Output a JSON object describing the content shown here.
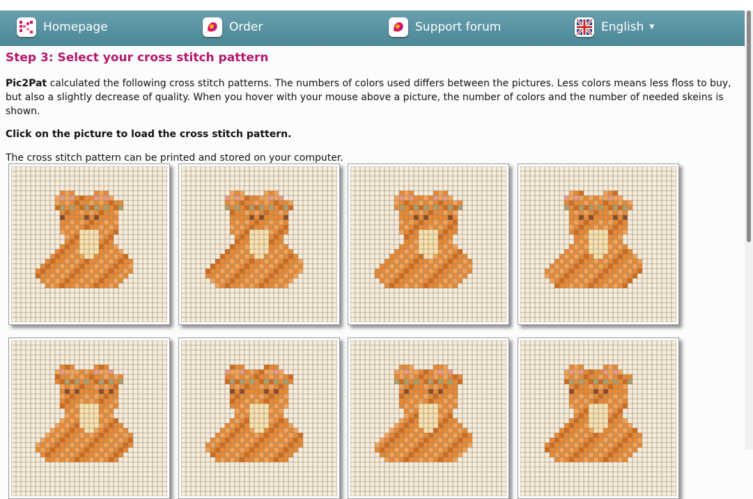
{
  "nav": {
    "items": [
      {
        "label": "Homepage",
        "icon": "pic2pat-logo-icon"
      },
      {
        "label": "Order",
        "icon": "order-icon"
      },
      {
        "label": "Support forum",
        "icon": "support-icon"
      },
      {
        "label": "English",
        "icon": "uk-flag-icon",
        "dropdown": true
      }
    ]
  },
  "main": {
    "heading": "Step 3: Select your cross stitch pattern",
    "brand": "Pic2Pat",
    "intro": " calculated the following cross stitch patterns. The numbers of colors used differs between the pictures. Less colors means less floss to buy, but also a slightly decrease of quality. When you hover with your mouse above a picture, the number of colors and the number of needed skeins is shown.",
    "instruction": "Click on the picture to load the cross stitch pattern.",
    "note": "The cross stitch pattern can be printed and stored on your computer."
  },
  "patterns": {
    "count": 8,
    "colors": {
      "background": "#f7eddc",
      "grid": "#8c7e6a",
      "orange": "#e88a35",
      "light_orange": "#f2a45a",
      "dark_orange": "#d06a1e",
      "pale": "#f8e2b0",
      "brown": "#8a4a2a",
      "pink": "#e89a8a",
      "olive": "#a8a070"
    }
  }
}
